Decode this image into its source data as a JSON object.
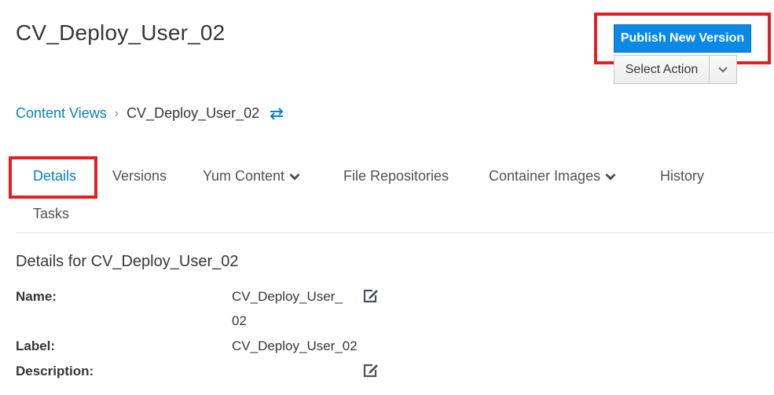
{
  "header": {
    "title": "CV_Deploy_User_02",
    "publish_label": "Publish New Version",
    "select_action_label": "Select Action"
  },
  "breadcrumb": {
    "parent": "Content Views",
    "separator": "›",
    "current": "CV_Deploy_User_02"
  },
  "tabs": [
    {
      "label": "Details",
      "active": true
    },
    {
      "label": "Versions"
    },
    {
      "label": "Yum Content",
      "dropdown": true
    },
    {
      "label": "File Repositories"
    },
    {
      "label": "Container Images",
      "dropdown": true
    },
    {
      "label": "History"
    },
    {
      "label": "Tasks"
    }
  ],
  "details": {
    "section_title": "Details for CV_Deploy_User_02",
    "name_label": "Name:",
    "name_value_line1": "CV_Deploy_User_",
    "name_value_line2": "02",
    "label_label": "Label:",
    "label_value": "CV_Deploy_User_02",
    "description_label": "Description:",
    "description_value": ""
  },
  "colors": {
    "primary": "#0a8ae6",
    "link": "#0a7ec2",
    "annotation": "#e31e24"
  },
  "icons": [
    "switch-arrows-icon",
    "chevron-down-icon",
    "edit-icon"
  ]
}
